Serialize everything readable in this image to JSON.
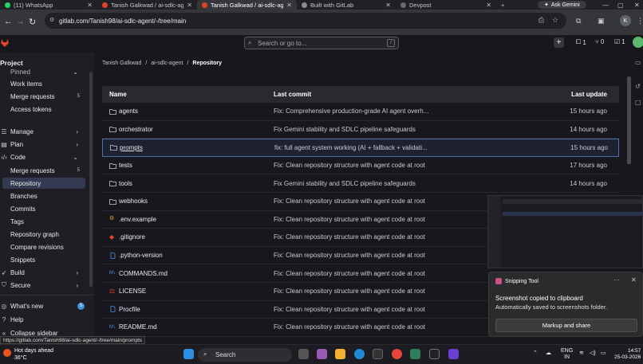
{
  "browser": {
    "tabs": [
      {
        "title": "(11) WhatsApp",
        "active": false
      },
      {
        "title": "Tanish Galkwad / ai-sdlc-agent",
        "active": false
      },
      {
        "title": "Tanish Galkwad / ai-sdlc-age",
        "active": true
      },
      {
        "title": "Built with GitLab",
        "active": false
      },
      {
        "title": "Devpost",
        "active": false
      }
    ],
    "ask_gemini": "Ask Gemini",
    "url": "gitlab.com/Tanish98/ai-sdlc-agent/-/tree/main",
    "profile_initial": "K"
  },
  "gitlab_top": {
    "search_placeholder": "Search or go to...",
    "search_shortcut": "/",
    "issues_count": "1",
    "mr_count": "0",
    "todo_count": "1"
  },
  "sidebar": {
    "project_label": "Project",
    "pinned_label": "Pinned",
    "items": [
      {
        "label": "Work items",
        "count": ""
      },
      {
        "label": "Merge requests",
        "count": "5"
      },
      {
        "label": "Access tokens",
        "count": ""
      }
    ],
    "sections": [
      {
        "label": "Manage",
        "icon": "manage-icon"
      },
      {
        "label": "Plan",
        "icon": "plan-icon"
      },
      {
        "label": "Code",
        "icon": "code-icon"
      }
    ],
    "code_items": [
      {
        "label": "Merge requests",
        "count": "5"
      },
      {
        "label": "Repository",
        "count": "",
        "active": true
      },
      {
        "label": "Branches",
        "count": ""
      },
      {
        "label": "Commits",
        "count": ""
      },
      {
        "label": "Tags",
        "count": ""
      },
      {
        "label": "Repository graph",
        "count": ""
      },
      {
        "label": "Compare revisions",
        "count": ""
      },
      {
        "label": "Snippets",
        "count": ""
      }
    ],
    "bottom_sections": [
      {
        "label": "Build",
        "icon": "rocket-icon"
      },
      {
        "label": "Secure",
        "icon": "shield-icon"
      }
    ],
    "whats_new": "What's new",
    "whats_new_count": "5",
    "help": "Help",
    "collapse": "Collapse sidebar"
  },
  "breadcrumbs": [
    "Tanish Galkwad",
    "ai-sdlc-agent",
    "Repository"
  ],
  "table": {
    "headers": {
      "name": "Name",
      "commit": "Last commit",
      "updated": "Last update"
    },
    "rows": [
      {
        "name": "agents",
        "type": "folder",
        "commit": "Fix: Comprehensive production-grade AI agent overh...",
        "updated": "15 hours ago"
      },
      {
        "name": "orchestrator",
        "type": "folder",
        "commit": "Fix Gemini stability and SDLC pipeline safeguards",
        "updated": "14 hours ago"
      },
      {
        "name": "prompts",
        "type": "folder",
        "commit": "fix: full agent system working (AI + fallback + validati...",
        "updated": "15 hours ago",
        "highlight": true
      },
      {
        "name": "tests",
        "type": "folder",
        "commit": "Fix: Clean repository structure with agent code at root",
        "updated": "17 hours ago"
      },
      {
        "name": "tools",
        "type": "folder",
        "commit": "Fix Gemini stability and SDLC pipeline safeguards",
        "updated": "14 hours ago"
      },
      {
        "name": "webhooks",
        "type": "folder",
        "commit": "Fix: Clean repository structure with agent code at root",
        "updated": ""
      },
      {
        "name": ".env.example",
        "type": "env",
        "commit": "Fix: Clean repository structure with agent code at root",
        "updated": ""
      },
      {
        "name": ".gitignore",
        "type": "git",
        "commit": "Fix: Clean repository structure with agent code at root",
        "updated": ""
      },
      {
        "name": ".python-version",
        "type": "file",
        "commit": "Fix: Clean repository structure with agent code at root",
        "updated": ""
      },
      {
        "name": "COMMANDS.md",
        "type": "md",
        "commit": "Fix: Clean repository structure with agent code at root",
        "updated": ""
      },
      {
        "name": "LICENSE",
        "type": "license",
        "commit": "Fix: Clean repository structure with agent code at root",
        "updated": ""
      },
      {
        "name": "Procfile",
        "type": "file",
        "commit": "Fix: Clean repository structure with agent code at root",
        "updated": ""
      },
      {
        "name": "README.md",
        "type": "md",
        "commit": "Fix: Clean repository structure with agent code at root",
        "updated": ""
      }
    ]
  },
  "snipping_toast": {
    "app": "Snipping Tool",
    "title": "Screenshot copied to clipboard",
    "subtitle": "Automatically saved to screenshots folder.",
    "button": "Markup and share"
  },
  "status_url": "https://gitlab.com/Tanish98/ai-sdlc-agent/-/tree/main/prompts",
  "taskbar": {
    "weather_line1": "Hot days ahead",
    "weather_line2": "36°C",
    "search": "Search",
    "lang1": "ENG",
    "lang2": "IN",
    "time": "14:57",
    "date": "25-03-2026"
  },
  "colors": {
    "accent": "#428fdc",
    "active_nav": "#333a52",
    "gitlab_orange": "#e24329"
  }
}
